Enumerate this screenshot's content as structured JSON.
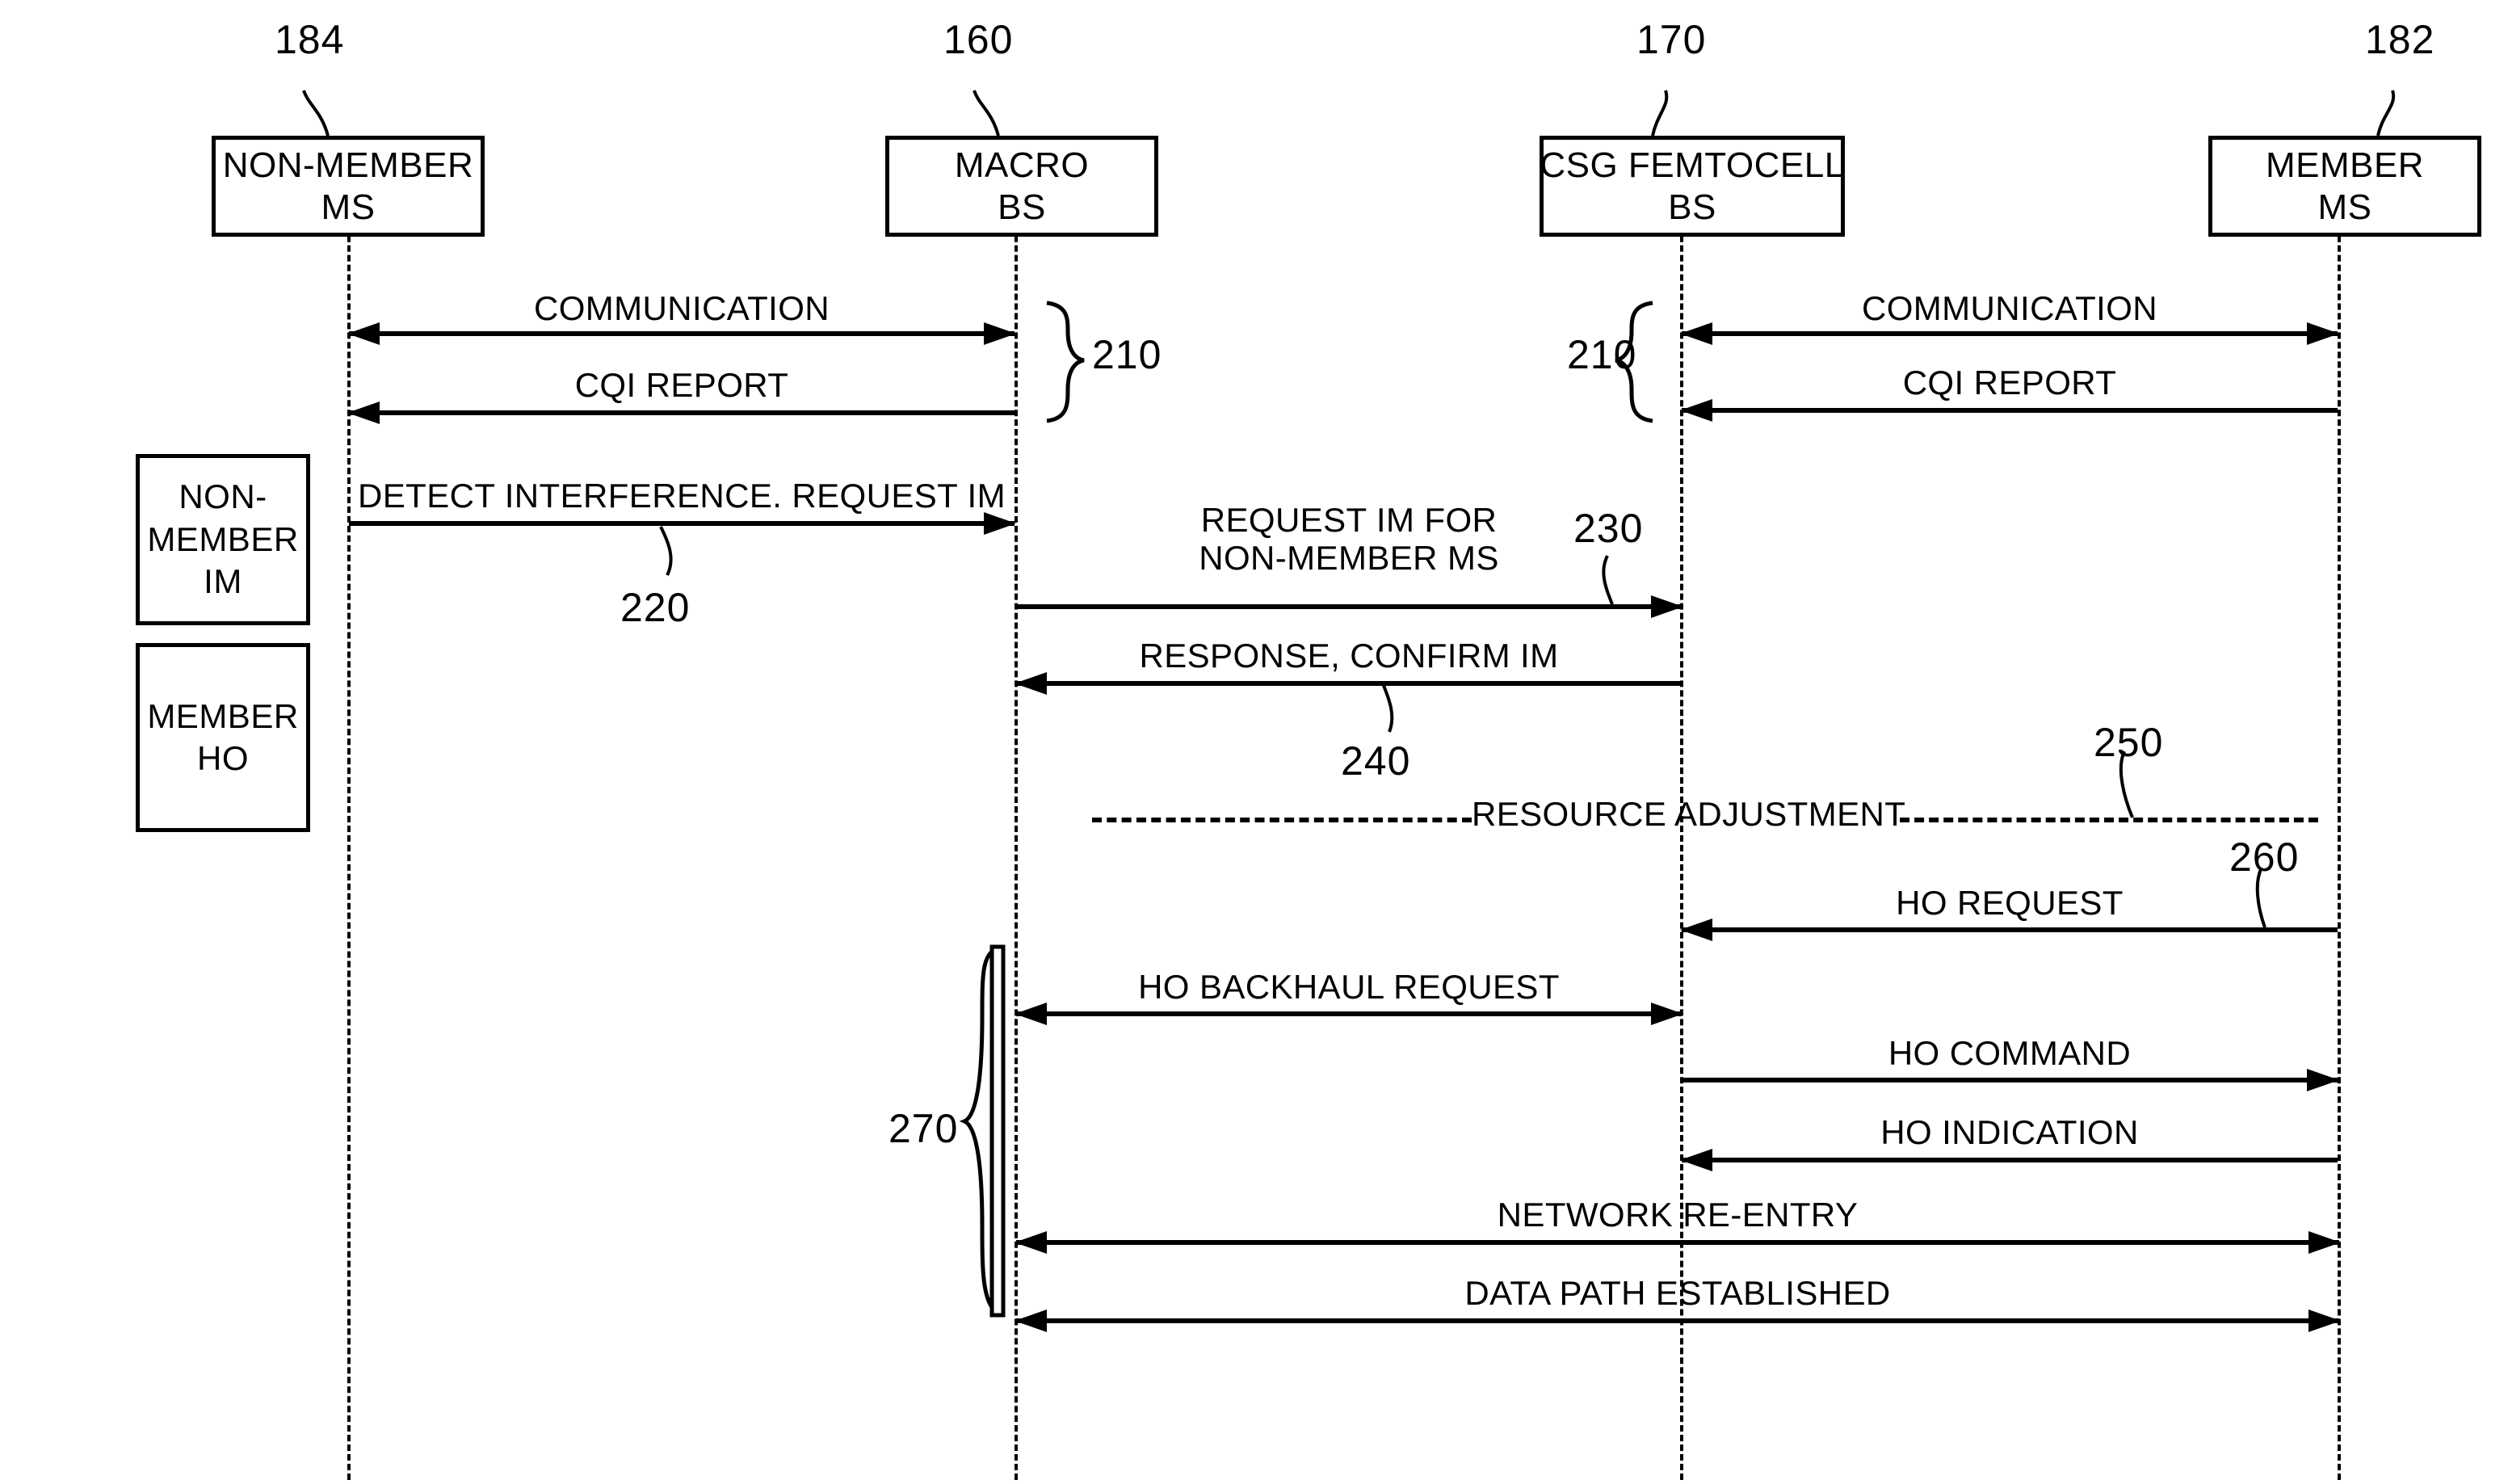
{
  "diagram": {
    "title": "CSG femtocell interference mitigation and handover sequence",
    "actors": [
      {
        "id": "non-member-ms",
        "label_line1": "NON-MEMBER",
        "label_line2": "MS",
        "ref": "184"
      },
      {
        "id": "macro-bs",
        "label_line1": "MACRO",
        "label_line2": "BS",
        "ref": "160"
      },
      {
        "id": "csg-femtocell-bs",
        "label_line1": "CSG FEMTOCELL",
        "label_line2": "BS",
        "ref": "170"
      },
      {
        "id": "member-ms",
        "label_line1": "MEMBER",
        "label_line2": "MS",
        "ref": "182"
      }
    ],
    "phases": [
      {
        "id": "non-member-im",
        "lines": "NON-\nMEMBER\nIM"
      },
      {
        "id": "member-ho",
        "lines": "MEMBER\nHO"
      }
    ],
    "messages": [
      {
        "id": "communication-left",
        "label": "COMMUNICATION",
        "from": "non-member-ms",
        "to": "macro-bs",
        "direction": "both"
      },
      {
        "id": "cqi-report-left",
        "label": "CQI REPORT",
        "from": "macro-bs",
        "to": "non-member-ms",
        "direction": "left"
      },
      {
        "id": "communication-right",
        "label": "COMMUNICATION",
        "from": "csg-femtocell-bs",
        "to": "member-ms",
        "direction": "both"
      },
      {
        "id": "cqi-report-right",
        "label": "CQI REPORT",
        "from": "member-ms",
        "to": "csg-femtocell-bs",
        "direction": "left"
      },
      {
        "id": "detect-interference",
        "label": "DETECT INTERFERENCE. REQUEST IM",
        "from": "non-member-ms",
        "to": "macro-bs",
        "direction": "right"
      },
      {
        "id": "request-im",
        "label": "REQUEST IM FOR\nNON-MEMBER MS",
        "from": "macro-bs",
        "to": "csg-femtocell-bs",
        "direction": "right"
      },
      {
        "id": "response-confirm-im",
        "label": "RESPONSE, CONFIRM IM",
        "from": "csg-femtocell-bs",
        "to": "macro-bs",
        "direction": "left"
      },
      {
        "id": "resource-adjustment",
        "label": "RESOURCE ADJUSTMENT",
        "from": "macro-bs",
        "to": "member-ms",
        "direction": "dashed"
      },
      {
        "id": "ho-request",
        "label": "HO REQUEST",
        "from": "member-ms",
        "to": "csg-femtocell-bs",
        "direction": "left"
      },
      {
        "id": "ho-backhaul-request",
        "label": "HO BACKHAUL REQUEST",
        "from": "macro-bs",
        "to": "csg-femtocell-bs",
        "direction": "both"
      },
      {
        "id": "ho-command",
        "label": "HO COMMAND",
        "from": "csg-femtocell-bs",
        "to": "member-ms",
        "direction": "right"
      },
      {
        "id": "ho-indication",
        "label": "HO INDICATION",
        "from": "member-ms",
        "to": "csg-femtocell-bs",
        "direction": "left"
      },
      {
        "id": "network-re-entry",
        "label": "NETWORK RE-ENTRY",
        "from": "macro-bs",
        "to": "member-ms",
        "direction": "both"
      },
      {
        "id": "data-path-established",
        "label": "DATA PATH ESTABLISHED",
        "from": "macro-bs",
        "to": "member-ms",
        "direction": "both"
      }
    ],
    "reference_numerals": [
      {
        "id": "ref-210-left",
        "value": "210"
      },
      {
        "id": "ref-210-right",
        "value": "210"
      },
      {
        "id": "ref-220",
        "value": "220"
      },
      {
        "id": "ref-230",
        "value": "230"
      },
      {
        "id": "ref-240",
        "value": "240"
      },
      {
        "id": "ref-250",
        "value": "250"
      },
      {
        "id": "ref-260",
        "value": "260"
      },
      {
        "id": "ref-270",
        "value": "270"
      }
    ],
    "labels": {
      "communication": "COMMUNICATION",
      "cqi_report": "CQI REPORT",
      "detect_interference": "DETECT INTERFERENCE. REQUEST IM",
      "request_im_l1": "REQUEST IM FOR",
      "request_im_l2": "NON-MEMBER MS",
      "response_confirm_im": "RESPONSE, CONFIRM IM",
      "resource_adjustment": "RESOURCE ADJUSTMENT",
      "ho_request": "HO REQUEST",
      "ho_backhaul_request": "HO BACKHAUL REQUEST",
      "ho_command": "HO COMMAND",
      "ho_indication": "HO INDICATION",
      "network_re_entry": "NETWORK RE-ENTRY",
      "data_path_established": "DATA PATH ESTABLISHED",
      "phase_non_member_l1": "NON-",
      "phase_non_member_l2": "MEMBER",
      "phase_non_member_l3": "IM",
      "phase_member_ho_l1": "MEMBER",
      "phase_member_ho_l2": "HO"
    },
    "colors": {
      "ink": "#000000",
      "paper": "#ffffff"
    }
  }
}
